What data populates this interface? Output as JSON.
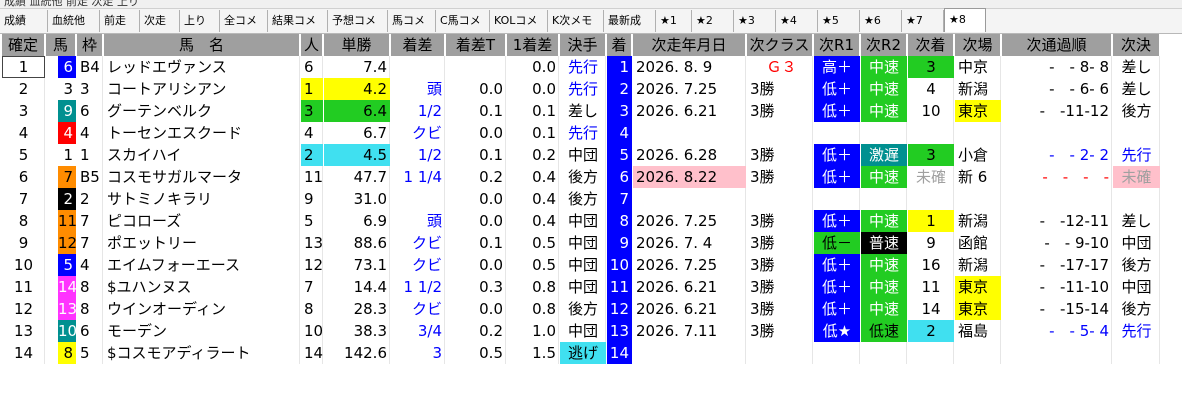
{
  "window_title": "成績 血統他 前走 次走 上り",
  "tabs": [
    {
      "label": "成績",
      "w": 48
    },
    {
      "label": "血統他",
      "w": 52
    },
    {
      "label": "前走",
      "w": 40
    },
    {
      "label": "次走",
      "w": 40
    },
    {
      "label": "上り",
      "w": 40
    },
    {
      "label": "全コメ",
      "w": 48
    },
    {
      "label": "結果コメ",
      "w": 60
    },
    {
      "label": "予想コメ",
      "w": 60
    },
    {
      "label": "馬コメ",
      "w": 48
    },
    {
      "label": "C馬コメ",
      "w": 54
    },
    {
      "label": "KOLコメ",
      "w": 58
    },
    {
      "label": "K次メモ",
      "w": 56
    },
    {
      "label": "最新成",
      "w": 52
    },
    {
      "label": "★1",
      "w": 36
    },
    {
      "label": "★2",
      "w": 42
    },
    {
      "label": "★3",
      "w": 42
    },
    {
      "label": "★4",
      "w": 42
    },
    {
      "label": "★5",
      "w": 42
    },
    {
      "label": "★6",
      "w": 42
    },
    {
      "label": "★7",
      "w": 42
    },
    {
      "label": "★8",
      "w": 42
    }
  ],
  "active_tab": 20,
  "headers": [
    "確定",
    "馬",
    "枠",
    "馬　名",
    "人",
    "単勝",
    "着差",
    "着差T",
    "1着差",
    "決手",
    "着",
    "次走年月日",
    "次クラス",
    "次R1",
    "次R2",
    "次着",
    "次場",
    "次通過順",
    "次決"
  ],
  "colors": {
    "header_bg": "#9f9f9f",
    "yellow": "#ffff00",
    "cyan": "#40e0f0",
    "green": "#22cc22",
    "pink": "#ffc0cb",
    "blue_cell": "#0000ff",
    "black": "#000000",
    "red": "#ff0000",
    "orange": "#ff8c00",
    "magenta": "#ff33ff",
    "teal": "#009090",
    "grass_bg": "#d0ffd0",
    "white": "#ffffff"
  },
  "rows": [
    {
      "pos": "1",
      "no": "6",
      "nobg": "#0000ff",
      "nofg": "#ffffff",
      "waku": "B4",
      "name": "レッドエヴァンス",
      "pop": "6",
      "odds": "7.4",
      "margin": "",
      "margint": "",
      "m1": "0.0",
      "kime": "先行",
      "kimeColor": "blue",
      "chaku": "1",
      "date": "2026. 8. 9",
      "cls": "Ｇ３",
      "clsRed": true,
      "r1": "高＋",
      "r1bg": "#0000ff",
      "r1fg": "#ffffff",
      "r2": "中速",
      "r2bg": "#22cc22",
      "r2fg": "#ffffff",
      "nchaku": "3",
      "nchakubg": "#22cc22",
      "nchakufg": "#000000",
      "place": "中京",
      "placebg": "",
      "tsuka": "-　- 8- 8",
      "tsukaBlue": false,
      "nkime": "差し",
      "nkimebg": ""
    },
    {
      "pos": "2",
      "no": "3",
      "nobg": "#ffffff",
      "nofg": "#000000",
      "waku": "3",
      "name": "コートアリシアン",
      "pop": "1",
      "popbg": "#ffff00",
      "odds": "4.2",
      "oddsbg": "#ffff00",
      "margin": "頭",
      "margint": "0.0",
      "m1": "0.0",
      "kime": "先行",
      "kimeColor": "blue",
      "chaku": "2",
      "date": "2026. 7.25",
      "cls": "3勝",
      "clsRed": false,
      "r1": "低＋",
      "r1bg": "#0000ff",
      "r1fg": "#ffffff",
      "r2": "中速",
      "r2bg": "#22cc22",
      "r2fg": "#ffffff",
      "nchaku": "4",
      "nchakubg": "",
      "nchakufg": "#000000",
      "place": "新潟",
      "placebg": "",
      "tsuka": "-　- 6- 6",
      "tsukaBlue": false,
      "nkime": "差し",
      "nkimebg": ""
    },
    {
      "pos": "3",
      "no": "9",
      "nobg": "#009090",
      "nofg": "#ffffff",
      "waku": "6",
      "name": "グーテンベルク",
      "pop": "3",
      "popbg": "#22cc22",
      "odds": "6.4",
      "oddsbg": "#22cc22",
      "margin": "1/2",
      "margint": "0.1",
      "m1": "0.1",
      "kime": "差し",
      "kimeColor": "",
      "chaku": "3",
      "date": "2026. 6.21",
      "cls": "3勝",
      "clsRed": false,
      "r1": "低＋",
      "r1bg": "#0000ff",
      "r1fg": "#ffffff",
      "r2": "中速",
      "r2bg": "#22cc22",
      "r2fg": "#ffffff",
      "nchaku": "10",
      "nchakubg": "",
      "nchakufg": "#000000",
      "place": "東京",
      "placebg": "#ffff00",
      "tsuka": "-　-11-12",
      "tsukaBlue": false,
      "nkime": "後方",
      "nkimebg": ""
    },
    {
      "pos": "4",
      "no": "4",
      "nobg": "#ff0000",
      "nofg": "#ffffff",
      "waku": "4",
      "name": "トーセンエスクード",
      "pop": "4",
      "odds": "6.7",
      "margin": "クビ",
      "margint": "0.0",
      "m1": "0.1",
      "kime": "先行",
      "kimeColor": "blue",
      "chaku": "4",
      "date": "",
      "cls": "",
      "clsRed": false,
      "r1": "",
      "r2": "",
      "nchaku": "",
      "place": "",
      "tsuka": "",
      "nkime": ""
    },
    {
      "pos": "5",
      "no": "1",
      "nobg": "#ffffff",
      "nofg": "#000000",
      "waku": "1",
      "name": "スカイハイ",
      "pop": "2",
      "popbg": "#40e0f0",
      "odds": "4.5",
      "oddsbg": "#40e0f0",
      "margin": "1/2",
      "margint": "0.1",
      "m1": "0.2",
      "kime": "中団",
      "kimeColor": "",
      "chaku": "5",
      "date": "2026. 6.28",
      "cls": "3勝",
      "clsRed": false,
      "r1": "低＋",
      "r1bg": "#0000ff",
      "r1fg": "#ffffff",
      "r2": "激遅",
      "r2bg": "#009090",
      "r2fg": "#ffffff",
      "nchaku": "3",
      "nchakubg": "#22cc22",
      "nchakufg": "#000000",
      "place": "小倉",
      "placebg": "",
      "tsuka": "-　- 2- 2",
      "tsukaBlue": true,
      "nkime": "先行",
      "nkimebg": "",
      "nkimeBlue": true
    },
    {
      "pos": "6",
      "no": "7",
      "nobg": "#ff8c00",
      "nofg": "#000000",
      "waku": "B5",
      "name": "コスモサガルマータ",
      "pop": "11",
      "odds": "47.7",
      "margin": "1 1/4",
      "margint": "0.2",
      "m1": "0.4",
      "kime": "後方",
      "kimeColor": "",
      "chaku": "6",
      "date": "2026. 8.22",
      "datebg": "#ffc0cb",
      "cls": "3勝",
      "clsRed": false,
      "r1": "低＋",
      "r1bg": "#0000ff",
      "r1fg": "#ffffff",
      "r2": "中速",
      "r2bg": "#22cc22",
      "r2fg": "#ffffff",
      "nchaku": "未確",
      "nchakubg": "",
      "nchakufg": "#a0a0a0",
      "place": "新 6",
      "placebg": "",
      "tsuka": "-　-　-　-",
      "tsukaBlue": false,
      "tsukaRed": true,
      "nkime": "未確",
      "nkimebg": "#ffc0cb"
    },
    {
      "pos": "7",
      "no": "2",
      "nobg": "#000000",
      "nofg": "#ffffff",
      "waku": "2",
      "name": "サトミノキラリ",
      "pop": "9",
      "odds": "31.0",
      "margin": "",
      "margint": "0.0",
      "m1": "0.4",
      "kime": "後方",
      "kimeColor": "",
      "chaku": "7",
      "date": "",
      "cls": "",
      "clsRed": false,
      "r1": "",
      "r2": "",
      "nchaku": "",
      "place": "",
      "tsuka": "",
      "nkime": ""
    },
    {
      "pos": "8",
      "no": "11",
      "nobg": "#ff8c00",
      "nofg": "#000000",
      "waku": "7",
      "name": "ピコローズ",
      "pop": "5",
      "odds": "6.9",
      "margin": "頭",
      "margint": "0.0",
      "m1": "0.4",
      "kime": "中団",
      "kimeColor": "",
      "chaku": "8",
      "date": "2026. 7.25",
      "cls": "3勝",
      "clsRed": false,
      "r1": "低＋",
      "r1bg": "#0000ff",
      "r1fg": "#ffffff",
      "r2": "中速",
      "r2bg": "#22cc22",
      "r2fg": "#ffffff",
      "nchaku": "1",
      "nchakubg": "#ffff00",
      "nchakufg": "#000000",
      "place": "新潟",
      "placebg": "",
      "tsuka": "-　-12-11",
      "tsukaBlue": false,
      "nkime": "差し",
      "nkimebg": ""
    },
    {
      "pos": "9",
      "no": "12",
      "nobg": "#ff8c00",
      "nofg": "#000000",
      "waku": "7",
      "name": "ポエットリー",
      "pop": "13",
      "odds": "88.6",
      "margin": "クビ",
      "margint": "0.1",
      "m1": "0.5",
      "kime": "中団",
      "kimeColor": "",
      "chaku": "9",
      "date": "2026. 7. 4",
      "cls": "3勝",
      "clsRed": false,
      "r1": "低－",
      "r1bg": "#22cc22",
      "r1fg": "#000000",
      "r2": "普速",
      "r2bg": "#000000",
      "r2fg": "#ffffff",
      "nchaku": "9",
      "nchakubg": "",
      "nchakufg": "#000000",
      "place": "函館",
      "placebg": "",
      "tsuka": "-　- 9-10",
      "tsukaBlue": false,
      "nkime": "中団",
      "nkimebg": ""
    },
    {
      "pos": "10",
      "no": "5",
      "nobg": "#0000ff",
      "nofg": "#ffffff",
      "waku": "4",
      "name": "エイムフォーエース",
      "pop": "12",
      "odds": "73.1",
      "margin": "クビ",
      "margint": "0.0",
      "m1": "0.5",
      "kime": "中団",
      "kimeColor": "",
      "chaku": "10",
      "date": "2026. 7.25",
      "cls": "3勝",
      "clsRed": false,
      "r1": "低＋",
      "r1bg": "#0000ff",
      "r1fg": "#ffffff",
      "r2": "中速",
      "r2bg": "#22cc22",
      "r2fg": "#ffffff",
      "nchaku": "16",
      "nchakubg": "",
      "nchakufg": "#000000",
      "place": "新潟",
      "placebg": "",
      "tsuka": "-　-17-17",
      "tsukaBlue": false,
      "nkime": "後方",
      "nkimebg": ""
    },
    {
      "pos": "11",
      "no": "14",
      "nobg": "#ff33ff",
      "nofg": "#ffffff",
      "waku": "8",
      "name": "$ユハンヌス",
      "pop": "7",
      "odds": "14.4",
      "margin": "1 1/2",
      "margint": "0.3",
      "m1": "0.8",
      "kime": "中団",
      "kimeColor": "",
      "chaku": "11",
      "date": "2026. 6.21",
      "cls": "3勝",
      "clsRed": false,
      "r1": "低＋",
      "r1bg": "#0000ff",
      "r1fg": "#ffffff",
      "r2": "中速",
      "r2bg": "#22cc22",
      "r2fg": "#ffffff",
      "nchaku": "11",
      "nchakubg": "",
      "nchakufg": "#000000",
      "place": "東京",
      "placebg": "#ffff00",
      "tsuka": "-　-11-10",
      "tsukaBlue": false,
      "nkime": "中団",
      "nkimebg": ""
    },
    {
      "pos": "12",
      "no": "13",
      "nobg": "#ff33ff",
      "nofg": "#ffffff",
      "waku": "8",
      "name": "ウインオーディン",
      "pop": "8",
      "odds": "28.3",
      "margin": "クビ",
      "margint": "0.0",
      "m1": "0.8",
      "kime": "後方",
      "kimeColor": "",
      "chaku": "12",
      "date": "2026. 6.21",
      "cls": "3勝",
      "clsRed": false,
      "r1": "低＋",
      "r1bg": "#0000ff",
      "r1fg": "#ffffff",
      "r2": "中速",
      "r2bg": "#22cc22",
      "r2fg": "#ffffff",
      "nchaku": "14",
      "nchakubg": "",
      "nchakufg": "#000000",
      "place": "東京",
      "placebg": "#ffff00",
      "tsuka": "-　-15-14",
      "tsukaBlue": false,
      "nkime": "後方",
      "nkimebg": ""
    },
    {
      "pos": "13",
      "no": "10",
      "nobg": "#009090",
      "nofg": "#ffffff",
      "waku": "6",
      "name": "モーデン",
      "pop": "10",
      "odds": "38.3",
      "margin": "3/4",
      "margint": "0.2",
      "m1": "1.0",
      "kime": "中団",
      "kimeColor": "",
      "chaku": "13",
      "date": "2026. 7.11",
      "cls": "3勝",
      "clsRed": false,
      "r1": "低★",
      "r1bg": "#0000ff",
      "r1fg": "#ffffff",
      "r2": "低速",
      "r2bg": "#22cc22",
      "r2fg": "#000000",
      "nchaku": "2",
      "nchakubg": "#40e0f0",
      "nchakufg": "#000000",
      "place": "福島",
      "placebg": "",
      "tsuka": "-　- 5- 4",
      "tsukaBlue": true,
      "nkime": "先行",
      "nkimebg": "",
      "nkimeBlue": true
    },
    {
      "pos": "14",
      "no": "8",
      "nobg": "#ffff00",
      "nofg": "#000000",
      "waku": "5",
      "name": "$コスモアディラート",
      "pop": "14",
      "odds": "142.6",
      "margin": "3",
      "margint": "0.5",
      "m1": "1.5",
      "kime": "逃げ",
      "kimeColor": "cyanbg",
      "chaku": "14",
      "date": "",
      "cls": "",
      "clsRed": false,
      "r1": "",
      "r2": "",
      "nchaku": "",
      "place": "",
      "tsuka": "",
      "nkime": ""
    }
  ]
}
